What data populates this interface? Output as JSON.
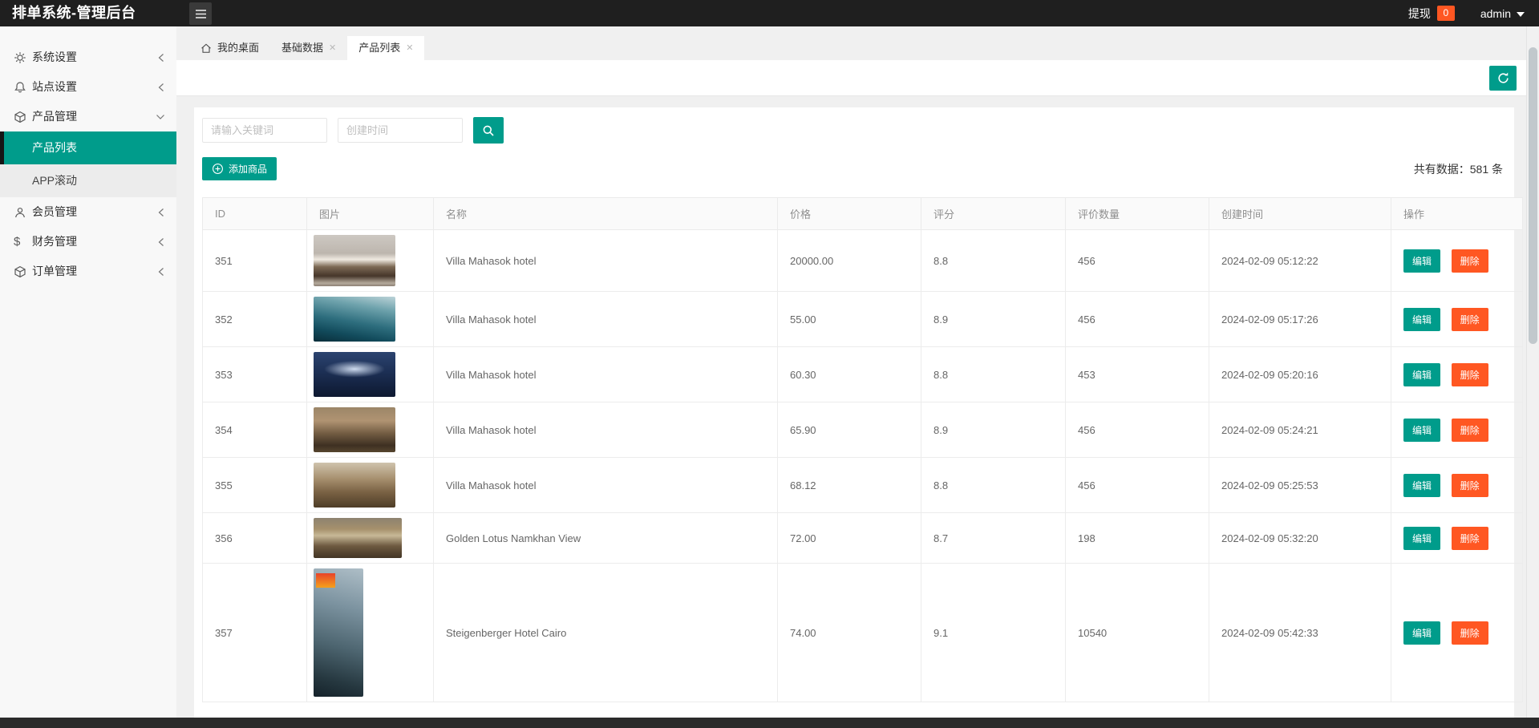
{
  "colors": {
    "accent": "#009c8b",
    "danger": "#ff5722",
    "topbar": "#1f1f1f",
    "active_menu": "#009c8b"
  },
  "topbar": {
    "title": "排单系统-管理后台",
    "withdraw_label": "提现",
    "withdraw_count": "0",
    "username": "admin"
  },
  "icons": {
    "close": "✕"
  },
  "tabs": [
    {
      "label": "我的桌面",
      "closable": false,
      "active": false
    },
    {
      "label": "基础数据",
      "closable": true,
      "active": false
    },
    {
      "label": "产品列表",
      "closable": true,
      "active": true
    }
  ],
  "sidebar": {
    "items": [
      {
        "label": "系统设置",
        "icon": "gear",
        "state": "collapsed"
      },
      {
        "label": "站点设置",
        "icon": "bell",
        "state": "collapsed"
      },
      {
        "label": "产品管理",
        "icon": "cube",
        "state": "expanded",
        "children": [
          {
            "label": "产品列表",
            "active": true
          },
          {
            "label": "APP滚动",
            "active": false
          }
        ]
      },
      {
        "label": "会员管理",
        "icon": "user",
        "state": "collapsed"
      },
      {
        "label": "财务管理",
        "icon": "dollar",
        "icon_glyph": "$",
        "state": "collapsed"
      },
      {
        "label": "订单管理",
        "icon": "cube",
        "state": "collapsed"
      }
    ]
  },
  "toolbar": {
    "search_placeholder": "请输入关键词",
    "date_placeholder": "创建时间",
    "add_button": "添加商品",
    "total_text": "共有数据：581 条"
  },
  "table": {
    "headers": [
      "ID",
      "图片",
      "名称",
      "价格",
      "评分",
      "评价数量",
      "创建时间",
      "操作"
    ],
    "edit_label": "编辑",
    "delete_label": "删除",
    "rows": [
      {
        "id": "351",
        "name": "Villa Mahasok hotel",
        "price": "20000.00",
        "score": "8.8",
        "reviews": "456",
        "created": "2024-02-09 05:12:22",
        "image": {
          "alt": "hotel bedroom photo",
          "style": "width:102px;height:64px;background:linear-gradient(180deg,#cdc8c2 0%,#bdb6ae 36%,#efe9e0 48%,#7d6a55 62%,#46362a 80%,#b4a99b 94%,#8c8075 100%)"
        }
      },
      {
        "id": "352",
        "name": "Villa Mahasok hotel",
        "price": "55.00",
        "score": "8.9",
        "reviews": "456",
        "created": "2024-02-09 05:17:26",
        "image": {
          "alt": "glass pool building photo",
          "style": "width:102px;height:56px;background:linear-gradient(190deg,#bcd3d8 0%,#6fa3ad 25%,#2e6e7e 55%,#124b5c 78%,#0a2e3a 100%)"
        }
      },
      {
        "id": "353",
        "name": "Villa Mahasok hotel",
        "price": "60.30",
        "score": "8.8",
        "reviews": "453",
        "created": "2024-02-09 05:20:16",
        "image": {
          "alt": "dark blue hall photo",
          "style": "width:102px;height:56px;background:radial-gradient(ellipse 60% 30% at 50% 38%,rgba(215,228,246,0.95),rgba(215,228,246,0) 62%),linear-gradient(180deg,#2c4470 0%,#1c2f54 45%,#0d1830 100%)"
        }
      },
      {
        "id": "354",
        "name": "Villa Mahasok hotel",
        "price": "65.90",
        "score": "8.9",
        "reviews": "456",
        "created": "2024-02-09 05:24:21",
        "image": {
          "alt": "restaurant interior photo",
          "style": "width:102px;height:56px;background:linear-gradient(180deg,#9b8668 0%,#b09372 30%,#6f5940 60%,#3e3022 85%,#57462f 100%)"
        }
      },
      {
        "id": "355",
        "name": "Villa Mahasok hotel",
        "price": "68.12",
        "score": "8.8",
        "reviews": "456",
        "created": "2024-02-09 05:25:53",
        "image": {
          "alt": "buffet area photo",
          "style": "width:102px;height:56px;background:linear-gradient(180deg,#cfc3ad 0%,#a89170 35%,#7b6345 65%,#4e3d27 100%)"
        }
      },
      {
        "id": "356",
        "name": "Golden Lotus Namkhan View",
        "price": "72.00",
        "score": "8.7",
        "reviews": "198",
        "created": "2024-02-09 05:32:20",
        "image": {
          "alt": "hotel lobby restaurant photo",
          "style": "width:110px;height:50px;background:linear-gradient(180deg,#8d8270 0%,#a6906c 28%,#c7b897 44%,#6d5940 70%,#433525 100%)"
        }
      },
      {
        "id": "357",
        "name": "Steigenberger Hotel Cairo",
        "price": "74.00",
        "score": "9.1",
        "reviews": "10540",
        "created": "2024-02-09 05:42:33",
        "image": {
          "alt": "hotel building facade with IHG logo",
          "style": "width:62px;height:160px;background:linear-gradient(#e8432a,#f5a11c) no-repeat 3px 6px/24px 18px,linear-gradient(195deg,#aebec7 0%,#7c93a0 30%,#4d6570 60%,#263840 85%,#15222a 100%)"
        }
      }
    ]
  }
}
